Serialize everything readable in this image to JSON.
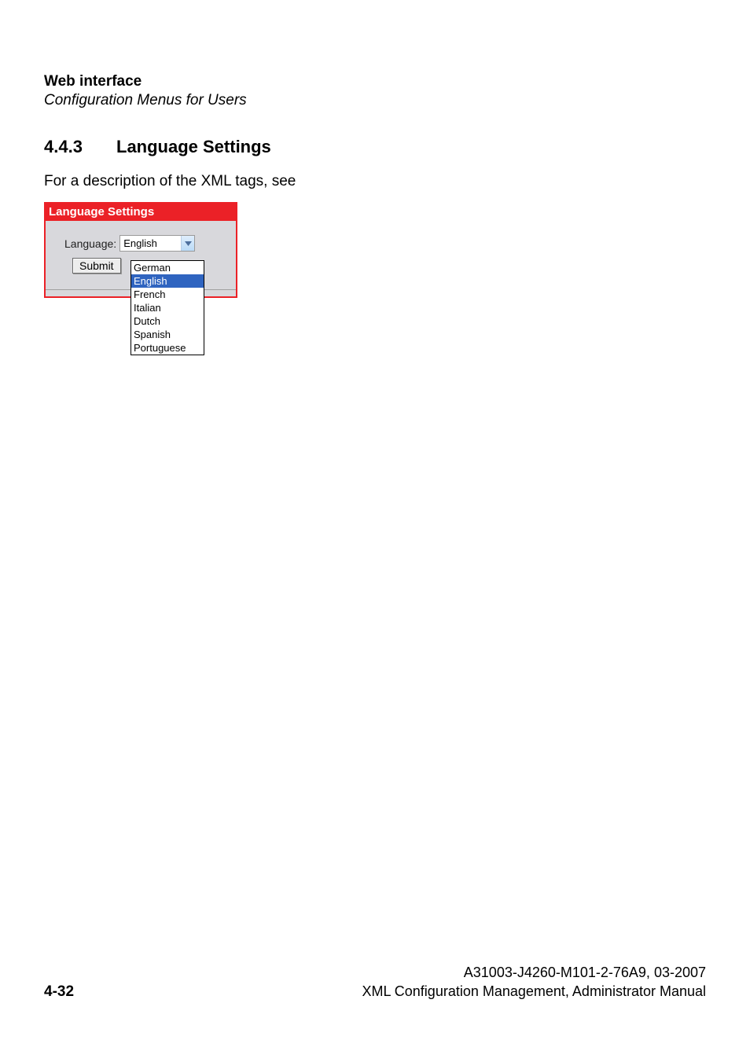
{
  "header": {
    "title": "Web interface",
    "subtitle": "Configuration Menus for Users"
  },
  "section": {
    "number": "4.4.3",
    "title": "Language Settings"
  },
  "description": "For a description of the XML tags, see",
  "panel": {
    "title": "Language Settings",
    "field_label": "Language:",
    "selected_value": "English",
    "submit_label": "Submit",
    "options": [
      {
        "label": "German",
        "selected": false
      },
      {
        "label": "English",
        "selected": true
      },
      {
        "label": "French",
        "selected": false
      },
      {
        "label": "Italian",
        "selected": false
      },
      {
        "label": "Dutch",
        "selected": false
      },
      {
        "label": "Spanish",
        "selected": false
      },
      {
        "label": "Portuguese",
        "selected": false
      }
    ]
  },
  "footer": {
    "doc_id": "A31003-J4260-M101-2-76A9, 03-2007",
    "doc_title": "XML Configuration Management, Administrator Manual",
    "page_number": "4-32"
  }
}
